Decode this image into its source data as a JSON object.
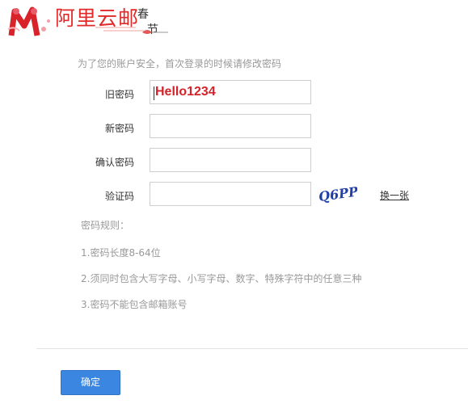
{
  "header": {
    "logo_text": "阿里云邮",
    "festival_char_1": "春",
    "festival_char_2": "节",
    "brand_color": "#e02a2a"
  },
  "form": {
    "notice": "为了您的账户安全，首次登录的时候请修改密码",
    "old_password": {
      "label": "旧密码",
      "value": "Hello1234"
    },
    "new_password": {
      "label": "新密码",
      "value": ""
    },
    "confirm_password": {
      "label": "确认密码",
      "value": ""
    },
    "captcha": {
      "label": "验证码",
      "value": "",
      "image_text": "Q6PP",
      "refresh_label": "换一张"
    }
  },
  "rules": {
    "title": "密码规则：",
    "items": [
      "1.密码长度8-64位",
      "2.须同时包含大写字母、小写字母、数字、特殊字符中的任意三种",
      "3.密码不能包含邮箱账号"
    ]
  },
  "actions": {
    "confirm_label": "确定",
    "accent_color": "#3a86e0"
  }
}
